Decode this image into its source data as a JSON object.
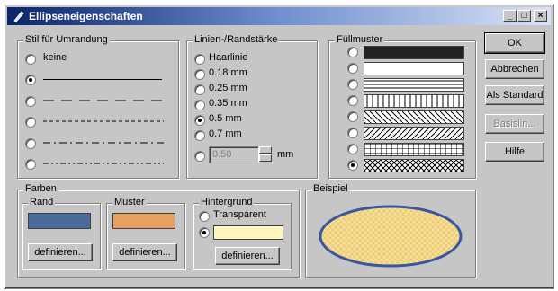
{
  "window": {
    "title": "Ellipseneigenschaften",
    "minimize_icon": "minimize-icon",
    "maximize_icon": "maximize-icon",
    "close_icon": "close-icon"
  },
  "border_style": {
    "title": "Stil für Umrandung",
    "options": [
      {
        "label": "keine",
        "checked": false
      },
      {
        "label": "",
        "pattern": "solid",
        "checked": true
      },
      {
        "label": "",
        "pattern": "long-dash",
        "checked": false
      },
      {
        "label": "",
        "pattern": "short-dash",
        "checked": false
      },
      {
        "label": "",
        "pattern": "dash-dot",
        "checked": false
      },
      {
        "label": "",
        "pattern": "dash-dot-dot",
        "checked": false
      }
    ]
  },
  "line_width": {
    "title": "Linien-/Randstärke",
    "options": [
      {
        "label": "Haarlinie",
        "checked": false
      },
      {
        "label": "0.18 mm",
        "checked": false
      },
      {
        "label": "0.25 mm",
        "checked": false
      },
      {
        "label": "0.35 mm",
        "checked": false
      },
      {
        "label": "0.5 mm",
        "checked": true
      },
      {
        "label": "0.7 mm",
        "checked": false
      }
    ],
    "custom_value": "0.50",
    "custom_unit": "mm"
  },
  "fill_pattern": {
    "title": "Füllmuster",
    "patterns": [
      "solid-dark",
      "empty",
      "horizontal",
      "vertical",
      "diagonal-down",
      "diagonal-up",
      "grid",
      "crosshatch"
    ],
    "selected_index": 7
  },
  "colors": {
    "title": "Farben",
    "border": {
      "title": "Rand",
      "color": "#4a6a9a",
      "button": "definieren..."
    },
    "pattern": {
      "title": "Muster",
      "color": "#e8a060",
      "button": "definieren..."
    },
    "background": {
      "title": "Hintergrund",
      "transparent_label": "Transparent",
      "transparent_checked": false,
      "color_checked": true,
      "color": "#fff7c0",
      "button": "definieren..."
    }
  },
  "preview": {
    "title": "Beispiel",
    "fill": "#f8e090",
    "border": "#5b74b8"
  },
  "buttons": {
    "ok": "OK",
    "cancel": "Abbrechen",
    "standard": "Als Standard",
    "restore": "Basislin...",
    "help": "Hilfe"
  }
}
